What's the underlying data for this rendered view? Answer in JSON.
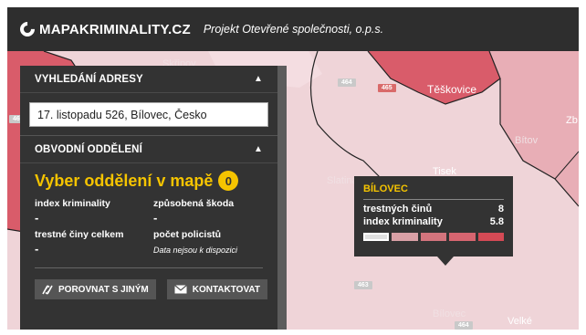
{
  "header": {
    "logo_text": "MAPAKRIMINALITY.CZ",
    "tagline": "Projekt Otevřené společnosti, o.p.s."
  },
  "map": {
    "places": [
      "Skřipov",
      "Těškovice",
      "Bítov",
      "Tisek",
      "Slatina",
      "Bílovec",
      "Velké",
      "Zb"
    ],
    "roads": [
      "464",
      "465",
      "463",
      "464",
      "462"
    ]
  },
  "panel": {
    "address_heading": "VYHLEDÁNÍ ADRESY",
    "address_value": "17. listopadu 526, Bílovec, Česko",
    "district_heading": "OBVODNÍ ODDĚLENÍ",
    "pick_title": "Vyber oddělení v mapě",
    "pick_count": "0",
    "stats": {
      "index_label": "index kriminality",
      "index_value": "-",
      "damage_label": "způsobená škoda",
      "damage_value": "-",
      "total_label": "trestné činy celkem",
      "total_value": "-",
      "police_label": "počet policistů",
      "police_value": "Data nejsou k dispozici"
    },
    "compare_button": "POROVNAT S JINÝM",
    "contact_button": "KONTAKTOVAT"
  },
  "tooltip": {
    "title": "BÍLOVEC",
    "crimes_label": "trestných činů",
    "crimes_value": "8",
    "index_label": "index kriminality",
    "index_value": "5.8",
    "scale_colors": [
      "#e0e0e0",
      "#d9a0a6",
      "#d3747d",
      "#d76570",
      "#d44a55"
    ]
  },
  "colors": {
    "header_bg": "#2e2e2e",
    "panel_bg": "#333333",
    "accent": "#f5c400",
    "region_light": "#efd4d8",
    "region_mid": "#e8aeb6",
    "region_dark": "#d95c6a"
  }
}
